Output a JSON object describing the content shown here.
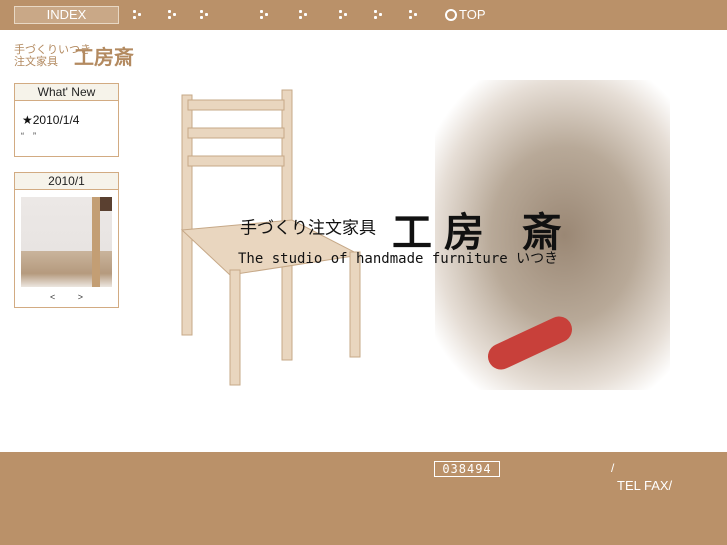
{
  "nav": {
    "index_label": "INDEX",
    "top_label": "TOP",
    "bullet_count": 8
  },
  "logo": {
    "line1": "手づくりいつき",
    "line2": "注文家具",
    "big": "工房斎"
  },
  "whats_new": {
    "title": "What' New",
    "date": "★2010/1/4",
    "quote": "“　”"
  },
  "calendar": {
    "title": "2010/1",
    "prev": "<",
    "next": ">"
  },
  "hero": {
    "title": "手づくり注文家具",
    "title_big": "工房 斎",
    "subtitle": "The studio of handmade furniture いつき"
  },
  "footer": {
    "counter": "038494",
    "slash": "/",
    "tel_fax": "TEL FAX/"
  }
}
